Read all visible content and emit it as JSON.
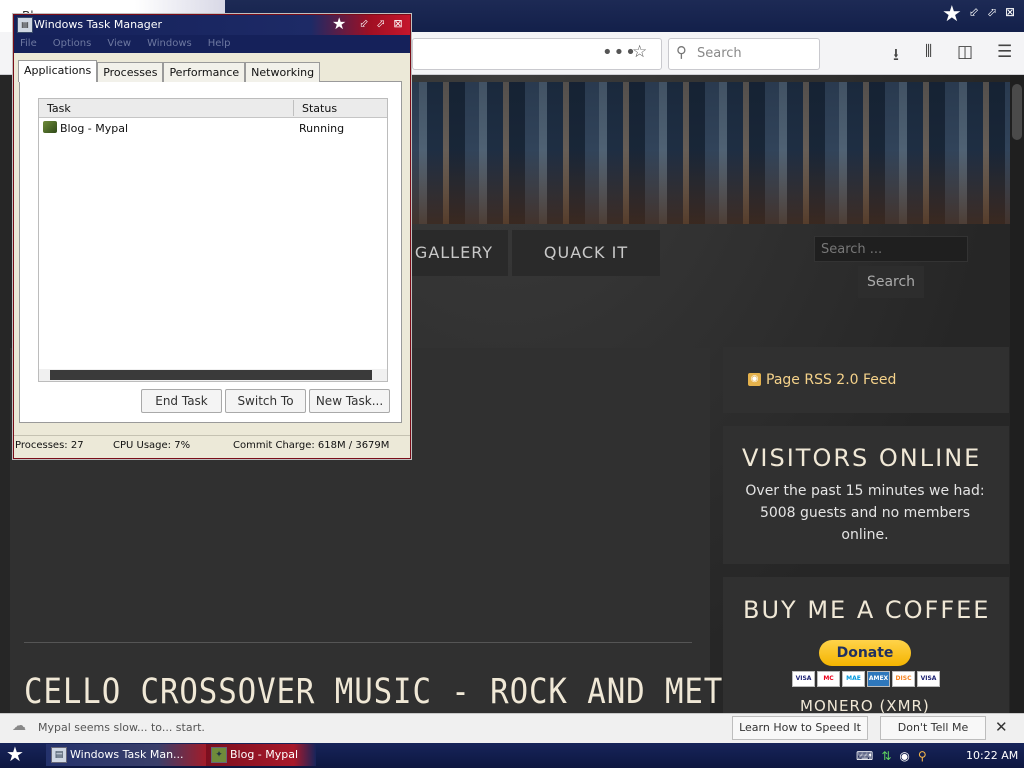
{
  "browser": {
    "title": "Bl...",
    "search_placeholder": "Search",
    "url_dots": "•••",
    "icons": [
      "download-icon",
      "library-icon",
      "sidebar-icon",
      "menu-icon",
      "bookmark-star-icon",
      "search-icon"
    ]
  },
  "site": {
    "menu": [
      {
        "label": "GALLERY"
      },
      {
        "label": "QUACK IT"
      }
    ],
    "search_placeholder": "Search ...",
    "search_button": "Search",
    "post_title": "CELLO CROSSOVER MUSIC - ROCK AND METAL",
    "rss_link": "Page RSS 2.0 Feed",
    "visitors": {
      "title": "VISITORS ONLINE",
      "text": "Over the past 15 minutes we had: 5008 guests and no members online."
    },
    "coffee": {
      "title": "BUY ME A COFFEE",
      "donate_label": "Donate",
      "cards": [
        "VISA",
        "MC",
        "MAE",
        "AMEX",
        "DISC",
        "VISA"
      ],
      "monero_label": "MONERO (XMR)"
    }
  },
  "notification": {
    "text": "Mypal seems slow... to... start.",
    "speed_button": "Learn How to Speed It Up",
    "dont_tell_button": "Don't Tell Me Again",
    "close": "✕"
  },
  "taskbar": {
    "tasks": [
      {
        "label": "Windows Task Man..."
      },
      {
        "label": "Blog - Mypal"
      }
    ],
    "clock": "10:22 AM"
  },
  "task_manager": {
    "title": "Windows Task Manager",
    "menu": [
      "File",
      "Options",
      "View",
      "Windows",
      "Help"
    ],
    "tabs": [
      "Applications",
      "Processes",
      "Performance",
      "Networking"
    ],
    "active_tab": "Applications",
    "columns": {
      "task": "Task",
      "status": "Status"
    },
    "rows": [
      {
        "task": "Blog - Mypal",
        "status": "Running"
      }
    ],
    "buttons": {
      "end_task": "End Task",
      "switch_to": "Switch To",
      "new_task": "New Task..."
    },
    "status": {
      "processes": "Processes: 27",
      "cpu": "CPU Usage: 7%",
      "commit": "Commit Charge: 618M / 3679M"
    }
  }
}
